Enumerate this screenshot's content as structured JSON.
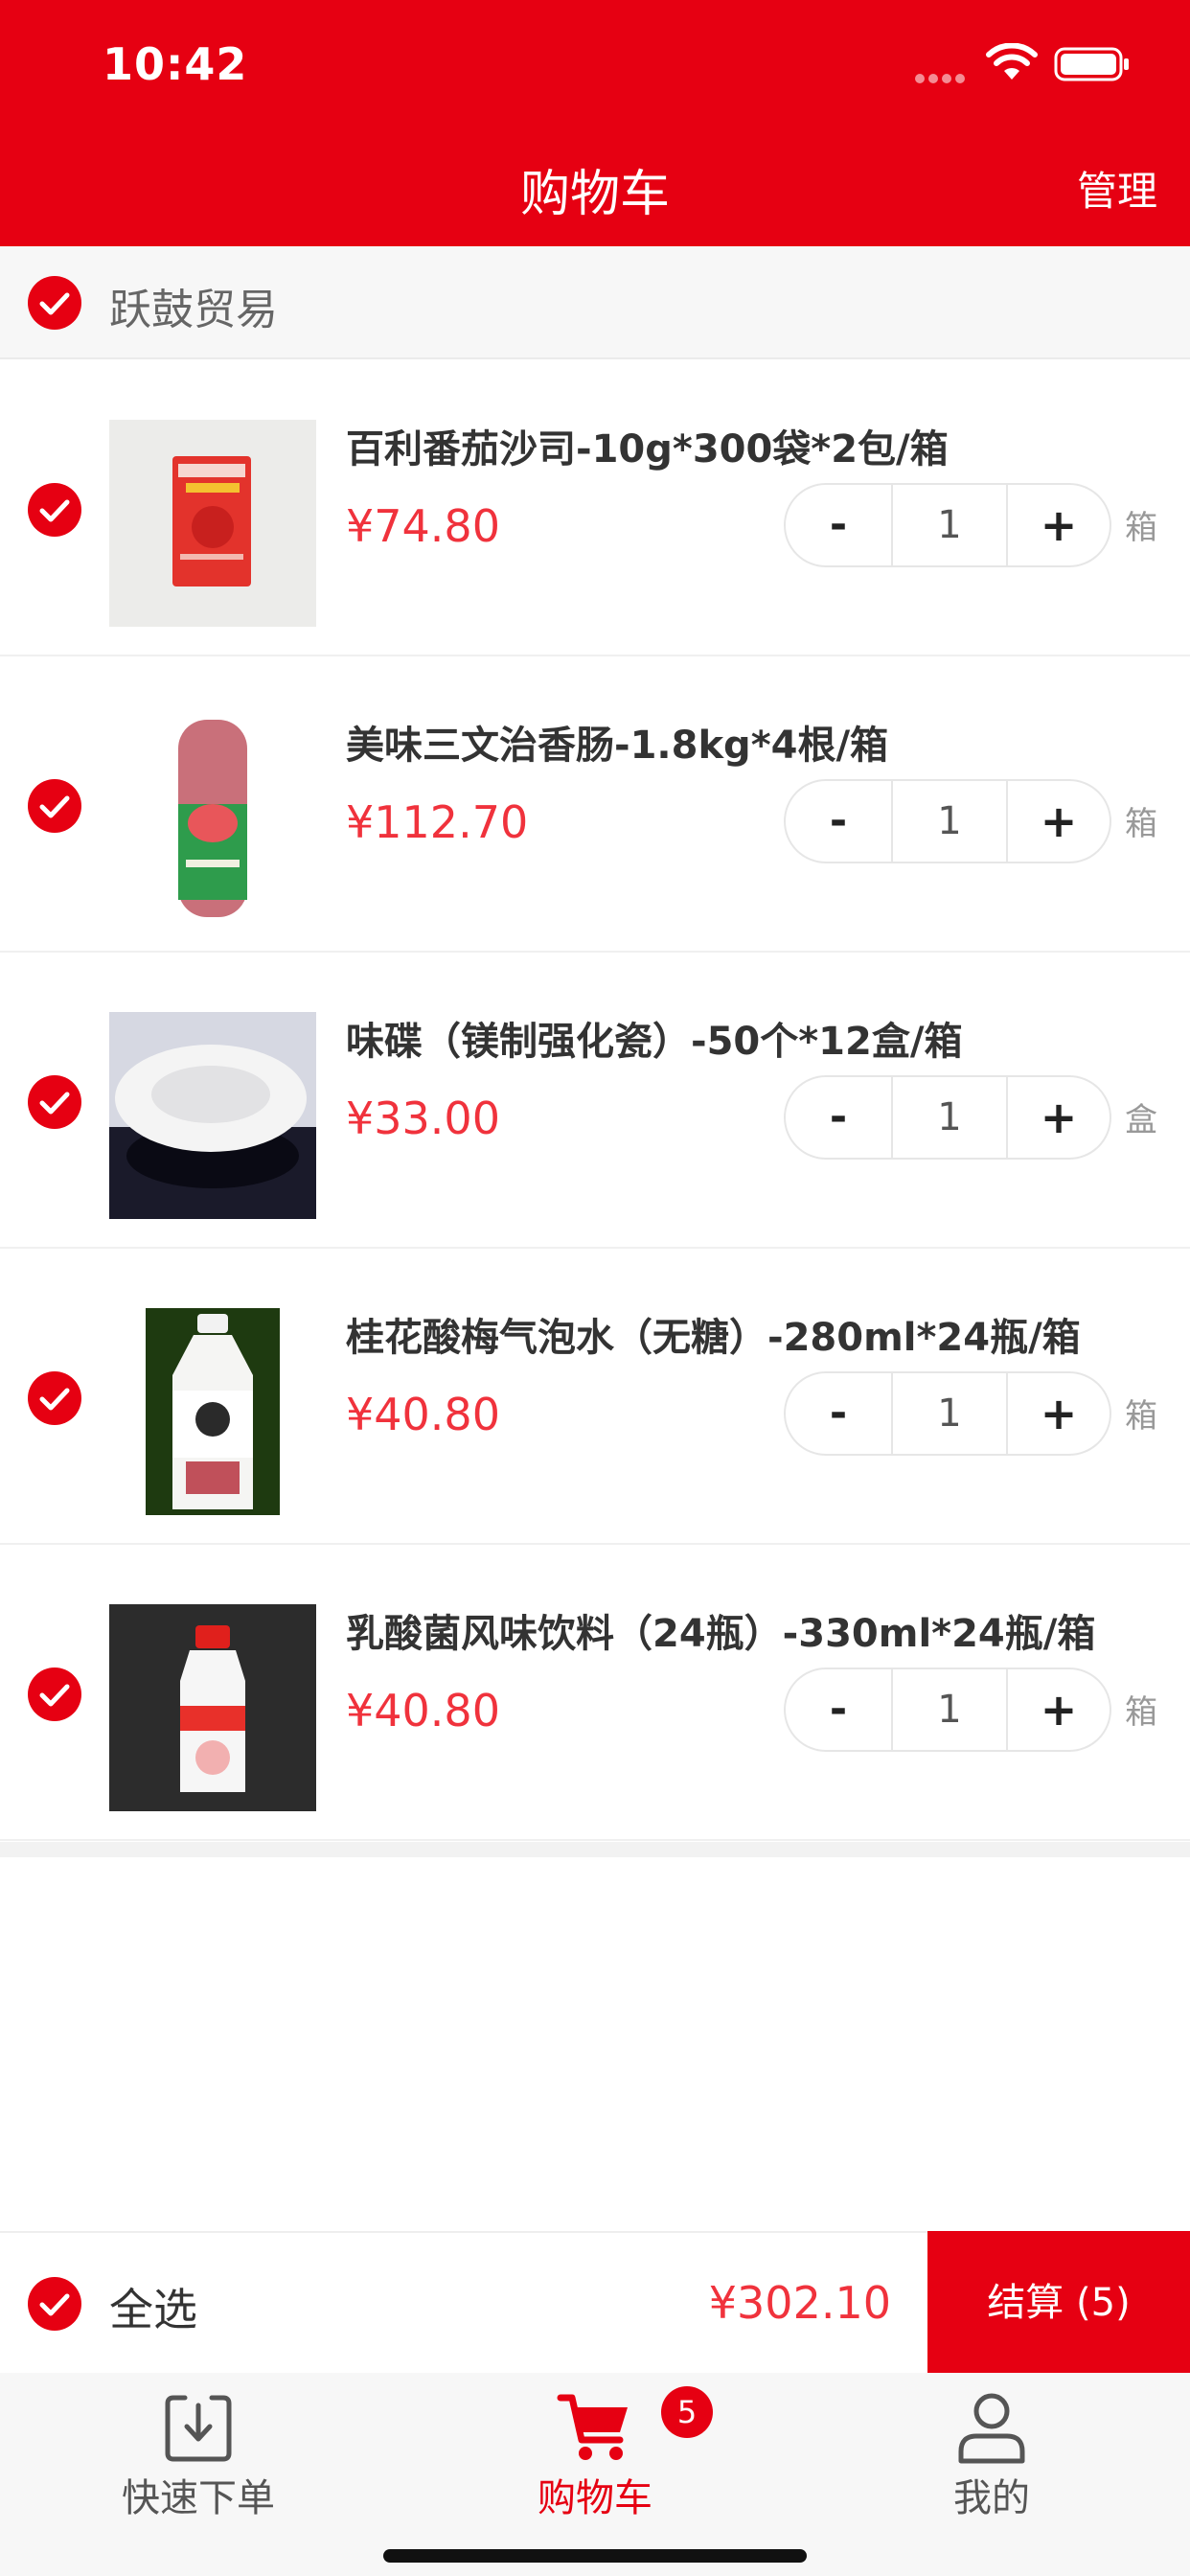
{
  "status_bar": {
    "time": "10:42"
  },
  "header": {
    "title": "购物车",
    "manage_label": "管理"
  },
  "shop": {
    "name": "跃鼓贸易",
    "checked": true
  },
  "items": [
    {
      "name": "百利番茄沙司-10g*300袋*2包/箱",
      "price": "¥74.80",
      "qty": "1",
      "unit": "箱",
      "checked": true,
      "image": "ketchup-packet"
    },
    {
      "name": "美味三文治香肠-1.8kg*4根/箱",
      "price": "¥112.70",
      "qty": "1",
      "unit": "箱",
      "checked": true,
      "image": "ham-sausage"
    },
    {
      "name": "味碟（镁制强化瓷）-50个*12盒/箱",
      "price": "¥33.00",
      "qty": "1",
      "unit": "盒",
      "checked": true,
      "image": "white-dish"
    },
    {
      "name": "桂花酸梅气泡水（无糖）-280ml*24瓶/箱",
      "price": "¥40.80",
      "qty": "1",
      "unit": "箱",
      "checked": true,
      "image": "soda-bottle"
    },
    {
      "name": "乳酸菌风味饮料（24瓶）-330ml*24瓶/箱",
      "price": "¥40.80",
      "qty": "1",
      "unit": "箱",
      "checked": true,
      "image": "yogurt-drink"
    }
  ],
  "stepper": {
    "minus": "-",
    "plus": "+"
  },
  "bottom_bar": {
    "select_all_label": "全选",
    "total": "¥302.10",
    "checkout_label": "结算 (5)"
  },
  "tabs": [
    {
      "label": "快速下单",
      "icon": "download-box-icon",
      "active": false
    },
    {
      "label": "购物车",
      "icon": "cart-icon",
      "active": true,
      "badge": "5"
    },
    {
      "label": "我的",
      "icon": "user-icon",
      "active": false
    }
  ],
  "colors": {
    "brand": "#E60012",
    "price": "#F0323C",
    "text": "#333333",
    "muted": "#999999"
  }
}
